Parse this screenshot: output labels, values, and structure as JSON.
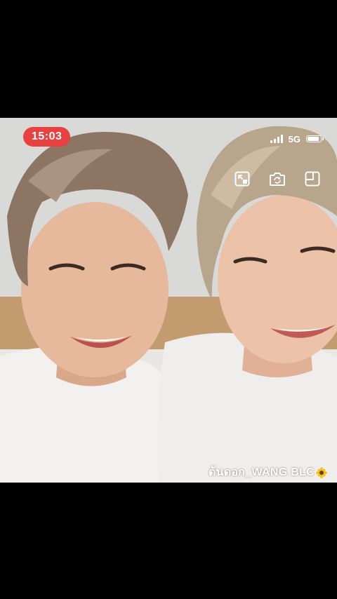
{
  "status_bar": {
    "time": "15:03",
    "network": "5G",
    "signal_bars": 4,
    "battery_level": 0.8
  },
  "camera_controls": [
    {
      "icon": "fullscreen-icon",
      "name": "resize-button"
    },
    {
      "icon": "camera-flip-icon",
      "name": "flip-camera-button"
    },
    {
      "icon": "layout-icon",
      "name": "layout-button"
    }
  ],
  "watermark": {
    "text": "ต้นดอก_WANG BLC",
    "icon": "sunflower-icon"
  },
  "colors": {
    "time_pill": "#e8413f",
    "letterbox": "#000000"
  }
}
